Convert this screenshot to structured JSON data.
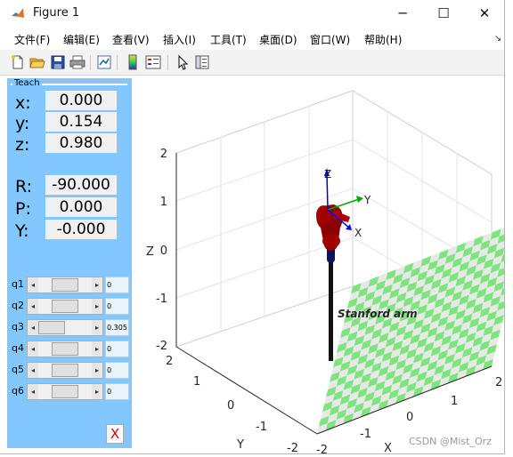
{
  "window": {
    "title": "Figure 1",
    "minimize": "─",
    "maximize": "☐",
    "close": "✕"
  },
  "menu": [
    {
      "label": "文件(F)"
    },
    {
      "label": "编辑(E)"
    },
    {
      "label": "查看(V)"
    },
    {
      "label": "插入(I)"
    },
    {
      "label": "工具(T)"
    },
    {
      "label": "桌面(D)"
    },
    {
      "label": "窗口(W)"
    },
    {
      "label": "帮助(H)"
    }
  ],
  "toolbar_icons": [
    "new-file-icon",
    "open-folder-icon",
    "save-icon",
    "print-icon",
    "link-plot-icon",
    "colorbar-icon",
    "legend-icon",
    "pointer-icon",
    "property-inspector-icon"
  ],
  "teach": {
    "title": "Teach",
    "pos": {
      "x_label": "x:",
      "x": "0.000",
      "y_label": "y:",
      "y": "0.154",
      "z_label": "z:",
      "z": "0.980"
    },
    "rpy": {
      "r_label": "R:",
      "r": "-90.000",
      "p_label": "P:",
      "p": "0.000",
      "yaw_label": "Y:",
      "yaw": "-0.000"
    },
    "joints": [
      {
        "label": "q1",
        "value": "0",
        "thumb_fraction": 0.5
      },
      {
        "label": "q2",
        "value": "0",
        "thumb_fraction": 0.5
      },
      {
        "label": "q3",
        "value": "0.305",
        "thumb_fraction": 0.0
      },
      {
        "label": "q4",
        "value": "0",
        "thumb_fraction": 0.5
      },
      {
        "label": "q5",
        "value": "0",
        "thumb_fraction": 0.5
      },
      {
        "label": "q6",
        "value": "0",
        "thumb_fraction": 0.5
      }
    ],
    "quit_label": "X"
  },
  "plot": {
    "robot_name": "Stanford arm",
    "z_label": "Z",
    "y_label": "Y",
    "x_label": "X",
    "z_ticks": [
      "2",
      "1",
      "0",
      "-1",
      "-2"
    ],
    "y_ticks": [
      "2",
      "1",
      "0",
      "-1",
      "-2"
    ],
    "x_ticks": [
      "2",
      "1",
      "0",
      "-1",
      "-2"
    ],
    "frame_labels": {
      "z": "Z",
      "y": "Y",
      "x": "X"
    },
    "colors": {
      "floor_a": "#7ee57e",
      "floor_b": "#e8e8e8",
      "link": "#8b0000",
      "frame_z": "#0000cc",
      "frame_y": "#00aa00",
      "frame_x": "#0000ff"
    }
  },
  "watermark": "CSDN @Mist_Orz"
}
